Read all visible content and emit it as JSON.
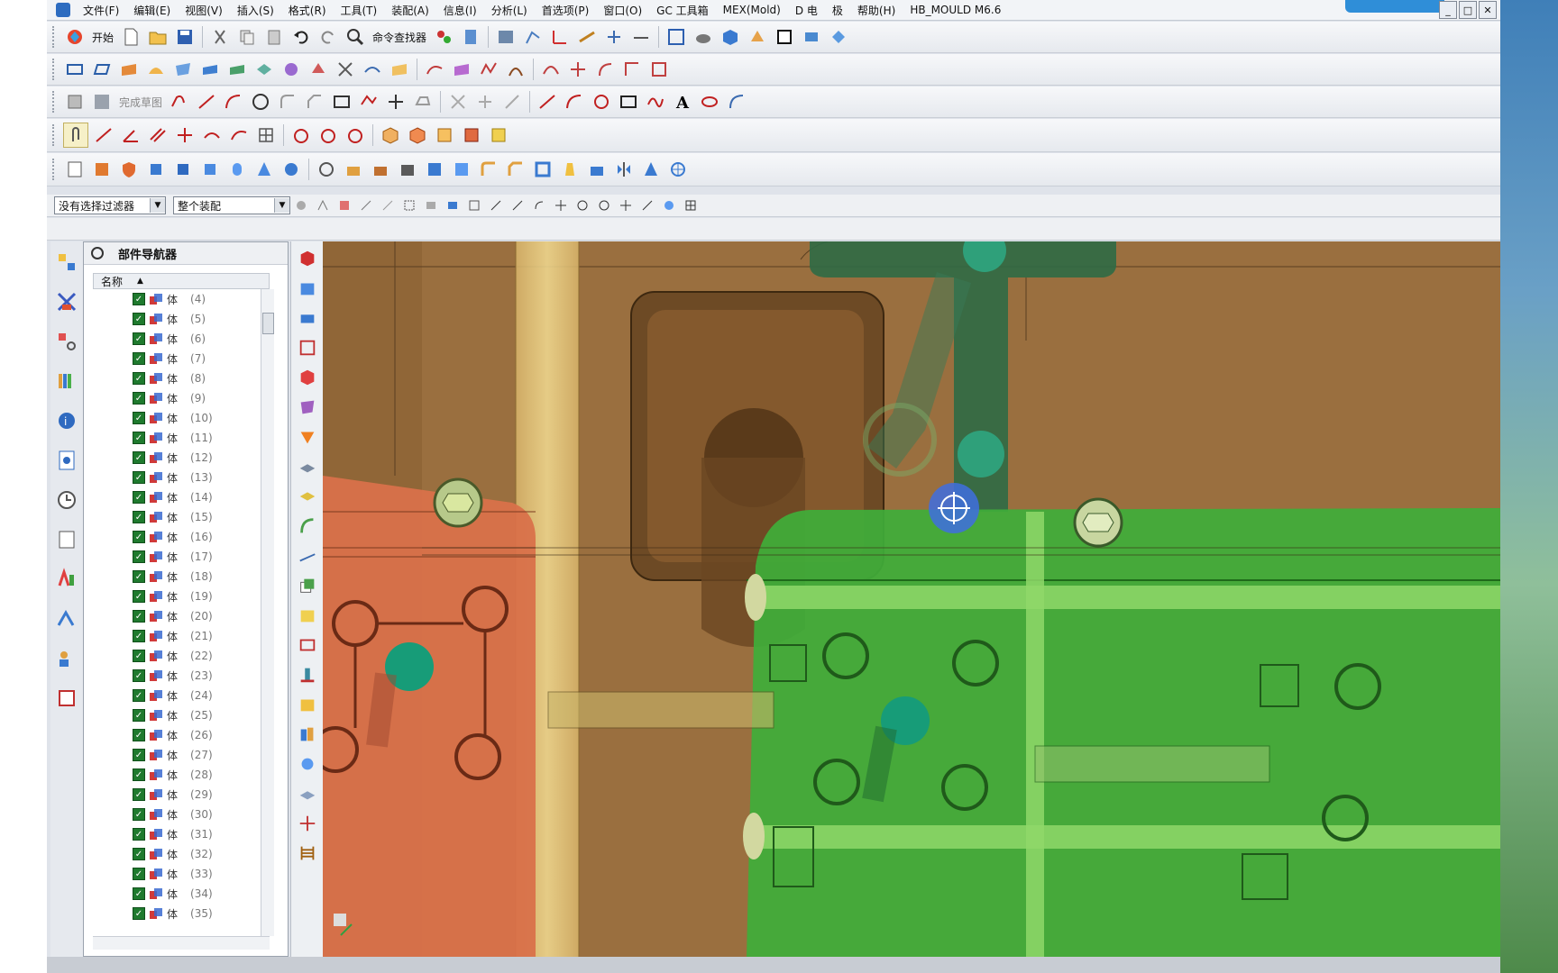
{
  "menu": {
    "items": [
      "文件(F)",
      "编辑(E)",
      "视图(V)",
      "插入(S)",
      "格式(R)",
      "工具(T)",
      "装配(A)",
      "信息(I)",
      "分析(L)",
      "首选项(P)",
      "窗口(O)",
      "GC 工具箱",
      "MEX(Mold)",
      "D 电",
      "极",
      "帮助(H)",
      "HB_MOULD M6.6"
    ]
  },
  "toolbar": {
    "start_label": "开始",
    "cmd_finder_label": "命令查找器",
    "finish_sketch_label": "完成草图"
  },
  "selection": {
    "filter_value": "没有选择过滤器",
    "scope_value": "整个装配"
  },
  "navigator": {
    "title": "部件导航器",
    "column_name": "名称",
    "rows": [
      {
        "label": "体",
        "index": "(4)"
      },
      {
        "label": "体",
        "index": "(5)"
      },
      {
        "label": "体",
        "index": "(6)"
      },
      {
        "label": "体",
        "index": "(7)"
      },
      {
        "label": "体",
        "index": "(8)"
      },
      {
        "label": "体",
        "index": "(9)"
      },
      {
        "label": "体",
        "index": "(10)"
      },
      {
        "label": "体",
        "index": "(11)"
      },
      {
        "label": "体",
        "index": "(12)"
      },
      {
        "label": "体",
        "index": "(13)"
      },
      {
        "label": "体",
        "index": "(14)"
      },
      {
        "label": "体",
        "index": "(15)"
      },
      {
        "label": "体",
        "index": "(16)"
      },
      {
        "label": "体",
        "index": "(17)"
      },
      {
        "label": "体",
        "index": "(18)"
      },
      {
        "label": "体",
        "index": "(19)"
      },
      {
        "label": "体",
        "index": "(20)"
      },
      {
        "label": "体",
        "index": "(21)"
      },
      {
        "label": "体",
        "index": "(22)"
      },
      {
        "label": "体",
        "index": "(23)"
      },
      {
        "label": "体",
        "index": "(24)"
      },
      {
        "label": "体",
        "index": "(25)"
      },
      {
        "label": "体",
        "index": "(26)"
      },
      {
        "label": "体",
        "index": "(27)"
      },
      {
        "label": "体",
        "index": "(28)"
      },
      {
        "label": "体",
        "index": "(29)"
      },
      {
        "label": "体",
        "index": "(30)"
      },
      {
        "label": "体",
        "index": "(31)"
      },
      {
        "label": "体",
        "index": "(32)"
      },
      {
        "label": "体",
        "index": "(33)"
      },
      {
        "label": "体",
        "index": "(34)"
      },
      {
        "label": "体",
        "index": "(35)"
      }
    ]
  },
  "colors": {
    "mold_brown": "#9a6f3f",
    "slider_orange": "#d9714a",
    "core_green": "#3fae3a",
    "accent_blue": "#2d6cc0"
  }
}
